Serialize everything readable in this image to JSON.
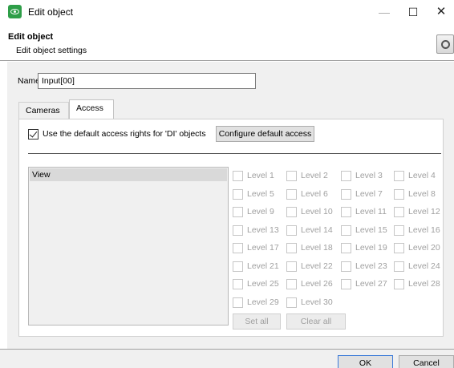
{
  "window": {
    "title": "Edit object",
    "icon": "eye-icon",
    "controls": {
      "minimize": "—",
      "maximize": "☐",
      "close": "✕"
    }
  },
  "header": {
    "title": "Edit object",
    "subtitle": "Edit object settings",
    "icon": "settings-icon"
  },
  "form": {
    "name_label": "Name",
    "name_value": "Input[00]"
  },
  "tabs": [
    {
      "label": "Cameras",
      "active": false
    },
    {
      "label": "Access",
      "active": true
    }
  ],
  "access": {
    "use_default_label": "Use the default access rights for 'DI' objects",
    "use_default_checked": true,
    "configure_button": "Configure default access",
    "rights_list": [
      "View"
    ],
    "levels": [
      "Level 1",
      "Level 2",
      "Level 3",
      "Level 4",
      "Level 5",
      "Level 6",
      "Level 7",
      "Level 8",
      "Level 9",
      "Level 10",
      "Level 11",
      "Level 12",
      "Level 13",
      "Level 14",
      "Level 15",
      "Level 16",
      "Level 17",
      "Level 18",
      "Level 19",
      "Level 20",
      "Level 21",
      "Level 22",
      "Level 23",
      "Level 24",
      "Level 25",
      "Level 26",
      "Level 27",
      "Level 28",
      "Level 29",
      "Level 30"
    ],
    "set_all": "Set all",
    "clear_all": "Clear all"
  },
  "footer": {
    "ok": "OK",
    "cancel": "Cancel"
  },
  "colors": {
    "app_icon": "#2e9e48",
    "disabled_text": "#a0a0a0",
    "ok_border": "#3b7ad8"
  }
}
